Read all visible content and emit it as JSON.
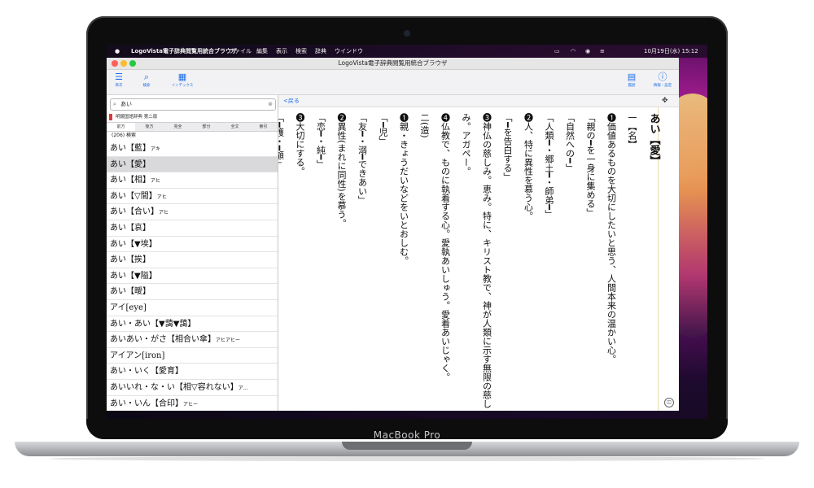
{
  "device": {
    "label": "MacBook Pro"
  },
  "menubar": {
    "apple_icon": "",
    "items": [
      "LogoVista電子辞典閲覧用統合ブラウザ",
      "ファイル",
      "編集",
      "表示",
      "検索",
      "辞典",
      "ウインドウ"
    ],
    "status_right": "10月19日(水)  15:12"
  },
  "window": {
    "title": "LogoVista電子辞典閲覧用統合ブラウザ",
    "toolbar": {
      "left": [
        {
          "icon": "list-icon",
          "label": "目次"
        },
        {
          "icon": "search-icon",
          "label": "検索"
        },
        {
          "icon": "grid-icon",
          "label": "インデックス"
        }
      ],
      "right": [
        {
          "icon": "dictionary-icon",
          "label": "履歴"
        },
        {
          "icon": "info-icon",
          "label": "情報・設定"
        }
      ]
    },
    "accent_color": "#1e6ee6"
  },
  "search": {
    "value": "あい",
    "placeholder": ""
  },
  "dictionary": {
    "name": "明鏡国語辞典 第二版"
  },
  "modes": [
    {
      "label": "前方",
      "selected": true
    },
    {
      "label": "後方",
      "selected": false
    },
    {
      "label": "完全",
      "selected": false
    },
    {
      "label": "部分",
      "selected": false
    },
    {
      "label": "全文",
      "selected": false
    },
    {
      "label": "索引",
      "selected": false
    }
  ],
  "result_count": "(206) 検索",
  "results": [
    {
      "head": "あい【藍】",
      "reading": "アキ"
    },
    {
      "head": "あい【愛】",
      "reading": ""
    },
    {
      "head": "あい【相】",
      "reading": "アヒ"
    },
    {
      "head": "あい【▽間】",
      "reading": "アヒ"
    },
    {
      "head": "あい【合い】",
      "reading": "アヒ"
    },
    {
      "head": "あい【哀】",
      "reading": ""
    },
    {
      "head": "あい【▼埃】",
      "reading": ""
    },
    {
      "head": "あい【挨】",
      "reading": ""
    },
    {
      "head": "あい【▼隘】",
      "reading": ""
    },
    {
      "head": "あい【曖】",
      "reading": ""
    },
    {
      "head": "アイ[eye]",
      "reading": ""
    },
    {
      "head": "あい・あい【▼藹▼藹】",
      "reading": ""
    },
    {
      "head": "あいあい・がさ【相合い傘】",
      "reading": "アヒアヒー"
    },
    {
      "head": "アイアン[iron]",
      "reading": ""
    },
    {
      "head": "あい・いく【愛育】",
      "reading": ""
    },
    {
      "head": "あいいれ・な・い【相▽容れない】",
      "reading": "ア…"
    },
    {
      "head": "あい・いん【合印】",
      "reading": "アヒー"
    },
    {
      "head": "あい・いん【愛飲】",
      "reading": ""
    }
  ],
  "selected_index": 1,
  "detail": {
    "back_label": "<戻る",
    "columns": [
      "あい【愛】",
      "一【名】",
      "❶価値あるものを大切にしたいと思う、人間本来の温かい心。",
      "「親の━を一身に集める」",
      "「自然への━」",
      "「人類━・郷土━・師弟━」",
      "❷人、特に異性を慕う心。",
      "「━を告白する」",
      "❸神仏の慈しみ。恵み。特に、キリスト教で、神が人類に示す無限の慈し",
      "み。アガペー。",
      "❹仏教で、ものに執着する心。愛執あいしゅう。愛着あいじゃく。",
      "二(造)",
      "❶親・きょうだいなどをいとおしむ。",
      "「━児」",
      "「友━・溺━できあい」",
      "❷異性(まれに同性)を慕う。",
      "「恋━・純━」",
      "❸大切にする。",
      "「━護・━顧」",
      "❹好ましく思う。"
    ]
  }
}
